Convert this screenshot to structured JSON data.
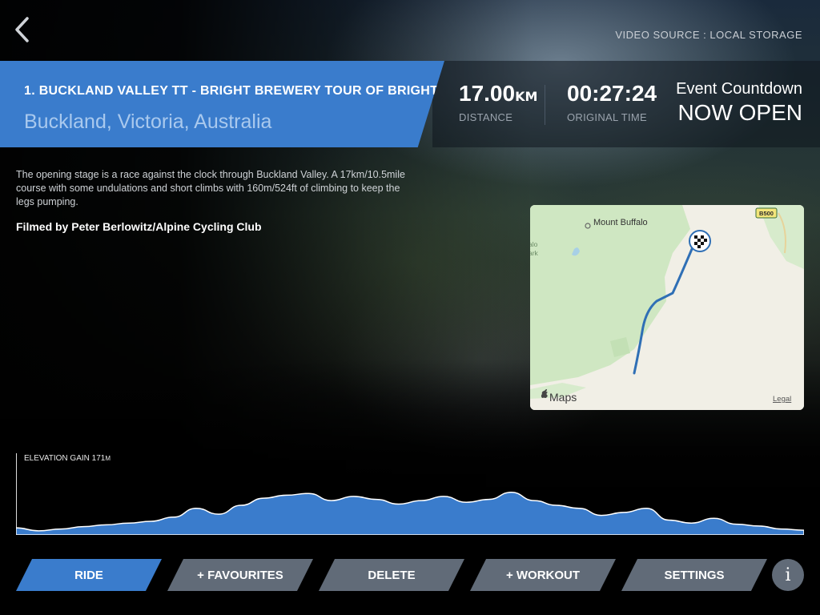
{
  "header": {
    "back_icon": "chevron-left-icon",
    "video_source": "VIDEO SOURCE : LOCAL STORAGE"
  },
  "route": {
    "title": "1.  BUCKLAND VALLEY TT - BRIGHT BREWERY TOUR OF BRIGHT",
    "location": "Buckland, Victoria, Australia",
    "description": "The opening stage is a race against the clock through Buckland Valley. A 17km/10.5mile course with some undulations and short climbs with 160m/524ft of climbing to keep the legs pumping.",
    "credit": "Filmed by Peter Berlowitz/Alpine Cycling Club"
  },
  "stats": {
    "distance_value": "17.00",
    "distance_unit": "KM",
    "distance_label": "DISTANCE",
    "time_value": "00:27:24",
    "time_label": "ORIGINAL TIME",
    "countdown_title": "Event Countdown",
    "countdown_status": "NOW OPEN"
  },
  "map": {
    "place_label": "Mount Buffalo",
    "park_fragment_1": "alo",
    "park_fragment_2": "ark",
    "road_badge": "B500",
    "brand": "Maps",
    "legal": "Legal",
    "colors": {
      "land": "#f1efe6",
      "park": "#cfe7c2",
      "route": "#2f6fb5"
    }
  },
  "elevation": {
    "label": "ELEVATION GAIN 171",
    "unit": "M",
    "fill_color": "#3a7ccc",
    "profile": [
      0.12,
      0.07,
      0.1,
      0.14,
      0.17,
      0.2,
      0.23,
      0.3,
      0.45,
      0.35,
      0.5,
      0.62,
      0.67,
      0.7,
      0.58,
      0.65,
      0.6,
      0.52,
      0.58,
      0.65,
      0.55,
      0.6,
      0.72,
      0.58,
      0.5,
      0.45,
      0.33,
      0.38,
      0.45,
      0.25,
      0.2,
      0.28,
      0.18,
      0.15,
      0.1,
      0.08
    ]
  },
  "buttons": {
    "ride": "RIDE",
    "favourites": "+ FAVOURITES",
    "delete": "DELETE",
    "workout": "+ WORKOUT",
    "settings": "SETTINGS",
    "info": "i"
  }
}
